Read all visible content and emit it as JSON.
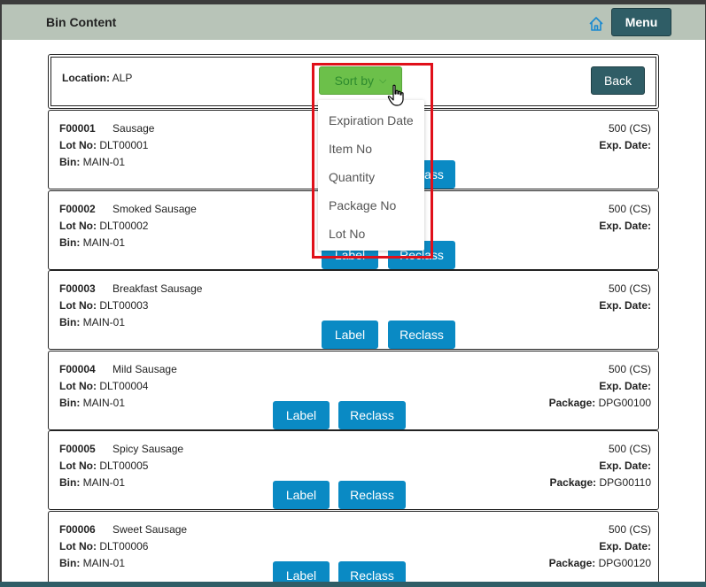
{
  "header": {
    "title": "Bin Content",
    "home_icon": "home-icon",
    "menu_label": "Menu"
  },
  "location": {
    "label": "Location:",
    "value": "ALP"
  },
  "sort": {
    "label": "Sort by",
    "chevron": "⌵",
    "options": [
      "Expiration Date",
      "Item No",
      "Quantity",
      "Package No",
      "Lot No"
    ]
  },
  "back_label": "Back",
  "field_labels": {
    "lot": "Lot No:",
    "bin": "Bin:",
    "exp": "Exp. Date:",
    "package": "Package:"
  },
  "button_labels": {
    "label": "Label",
    "reclass": "Reclass"
  },
  "items": [
    {
      "item_no": "F00001",
      "name": "Sausage",
      "lot": "DLT00001",
      "bin": "MAIN-01",
      "qty": "500 (CS)",
      "exp": "",
      "package": ""
    },
    {
      "item_no": "F00002",
      "name": "Smoked Sausage",
      "lot": "DLT00002",
      "bin": "MAIN-01",
      "qty": "500 (CS)",
      "exp": "",
      "package": ""
    },
    {
      "item_no": "F00003",
      "name": "Breakfast Sausage",
      "lot": "DLT00003",
      "bin": "MAIN-01",
      "qty": "500 (CS)",
      "exp": "",
      "package": ""
    },
    {
      "item_no": "F00004",
      "name": "Mild Sausage",
      "lot": "DLT00004",
      "bin": "MAIN-01",
      "qty": "500 (CS)",
      "exp": "",
      "package": "DPG00100"
    },
    {
      "item_no": "F00005",
      "name": "Spicy Sausage",
      "lot": "DLT00005",
      "bin": "MAIN-01",
      "qty": "500 (CS)",
      "exp": "",
      "package": "DPG00110"
    },
    {
      "item_no": "F00006",
      "name": "Sweet Sausage",
      "lot": "DLT00006",
      "bin": "MAIN-01",
      "qty": "500 (CS)",
      "exp": "",
      "package": "DPG00120"
    }
  ],
  "colors": {
    "primary": "#2f5d66",
    "action": "#0a8ac4",
    "sort": "#6cc04a",
    "highlight": "#e0101a"
  }
}
